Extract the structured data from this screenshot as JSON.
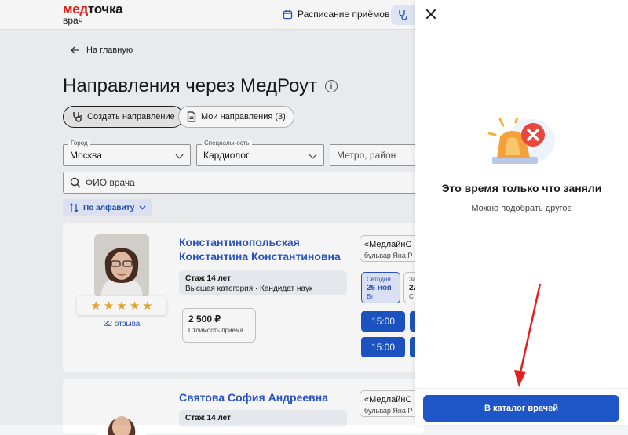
{
  "header": {
    "logo_med": "мед",
    "logo_tochka": "точка",
    "logo_sub": "врач",
    "schedule_link": "Расписание приёмов"
  },
  "main": {
    "back_label": "На главную",
    "title": "Направления через МедРоут",
    "buttons": {
      "create": "Создать направление",
      "mine": "Мои направления (3)"
    },
    "filters": {
      "city_label": "Город",
      "city_value": "Москва",
      "specialty_label": "Специальность",
      "specialty_value": "Кардиолог",
      "metro_placeholder": "Метро, район"
    },
    "search_placeholder": "ФИО врача",
    "sort_label": "По алфавиту"
  },
  "doctors": [
    {
      "name_line1": "Константинопольская",
      "name_line2": "Константина Константиновна",
      "rating": 5,
      "reviews": "32 отзыва",
      "experience": "Стаж 14 лет",
      "category": "Высшая категория · Кандидат наук",
      "price": "2 500 ₽",
      "price_label": "Стоимость приёма",
      "clinic": "«МедлайнС",
      "address": "бульвар Яна Р",
      "date_today_label": "Сегодня",
      "date_today": "26 ноя",
      "date_today_day": "Вт",
      "date_next_label": "За",
      "date_next": "27",
      "date_next_day": "С",
      "slots": [
        "15:00",
        "15:00"
      ]
    },
    {
      "name_line1": "Святова София Андреевна",
      "experience": "Стаж 14 лет",
      "clinic": "«МедлайнС",
      "address": "бульвар Яна Р"
    }
  ],
  "panel": {
    "title": "Это время только что заняли",
    "subtitle": "Можно подобрать другое",
    "catalog_button": "В каталог врачей"
  },
  "colors": {
    "accent": "#1e56c8",
    "brand_red": "#e2231a",
    "link": "#2a56c6",
    "alert_red": "#e8473f",
    "star": "#f0a82a"
  }
}
